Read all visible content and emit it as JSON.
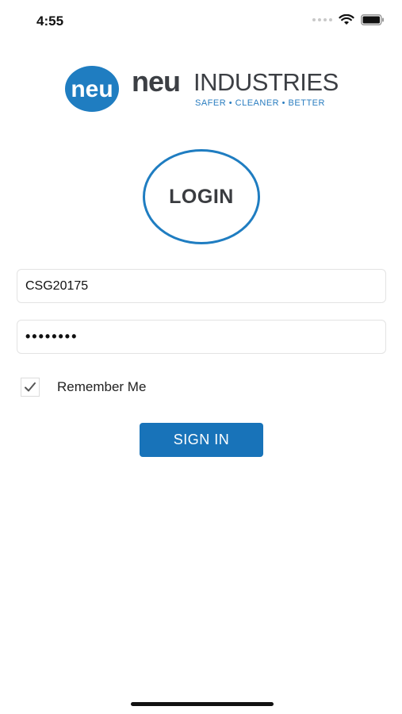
{
  "status_bar": {
    "time": "4:55"
  },
  "logo": {
    "circle_text": "neu",
    "brand_neu": "neu",
    "brand_industries": "INDUSTRIES",
    "tagline": "SAFER • CLEANER • BETTER",
    "accent_color": "#1f7dc1"
  },
  "login_badge": {
    "label": "LOGIN"
  },
  "form": {
    "username_value": "CSG20175",
    "password_value": "••••••••",
    "remember_checked": true,
    "remember_label": "Remember Me",
    "signin_label": "SIGN IN",
    "button_color": "#1873b9"
  },
  "icons": [
    "signal-icon",
    "wifi-icon",
    "battery-icon",
    "checkmark-icon"
  ]
}
